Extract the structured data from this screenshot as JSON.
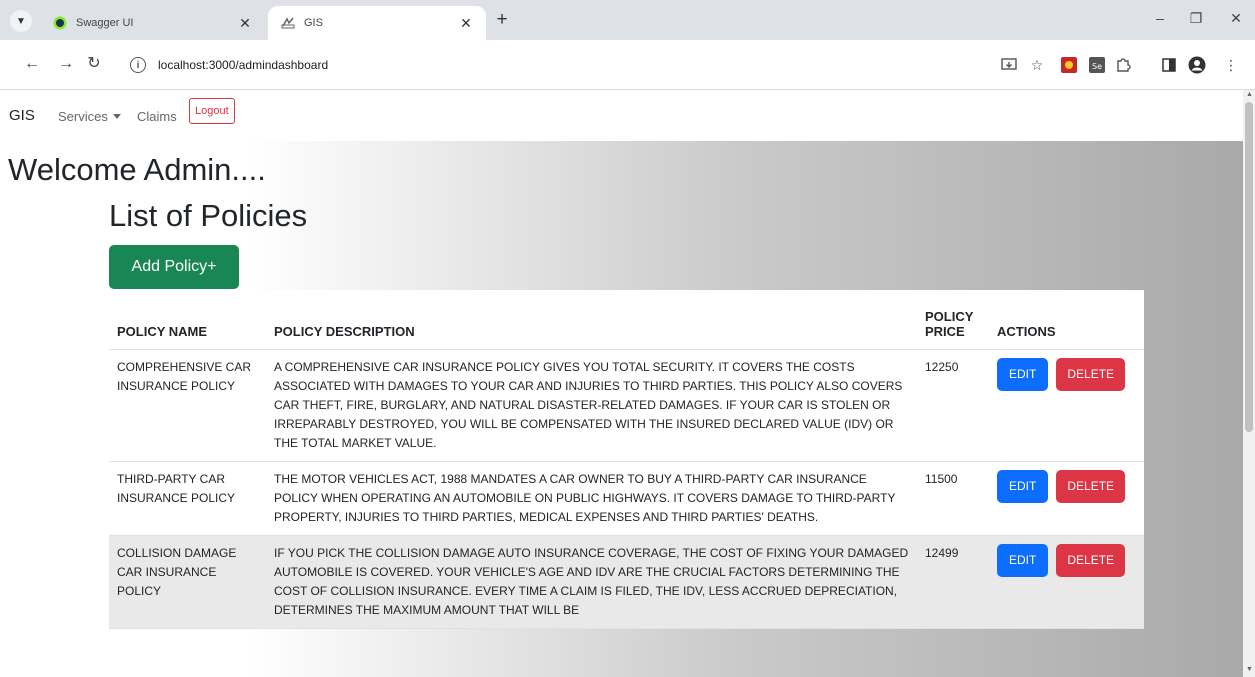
{
  "browser": {
    "tabs": [
      {
        "title": "Swagger UI",
        "active": false
      },
      {
        "title": "GIS",
        "active": true
      }
    ],
    "url": "localhost:3000/admindashboard"
  },
  "navbar": {
    "brand": "GIS",
    "services": "Services",
    "claims": "Claims",
    "logout": "Logout"
  },
  "page": {
    "welcome": "Welcome Admin....",
    "list_title": "List of Policies",
    "add_button": "Add Policy+"
  },
  "table": {
    "headers": {
      "name": "POLICY NAME",
      "description": "POLICY DESCRIPTION",
      "price": "POLICY PRICE",
      "actions": "ACTIONS"
    },
    "edit_label": "EDIT",
    "delete_label": "DELETE",
    "rows": [
      {
        "name": "COMPREHENSIVE CAR INSURANCE POLICY",
        "description": "A COMPREHENSIVE CAR INSURANCE POLICY GIVES YOU TOTAL SECURITY. IT COVERS THE COSTS ASSOCIATED WITH DAMAGES TO YOUR CAR AND INJURIES TO THIRD PARTIES. THIS POLICY ALSO COVERS CAR THEFT, FIRE, BURGLARY, AND NATURAL DISASTER-RELATED DAMAGES. IF YOUR CAR IS STOLEN OR IRREPARABLY DESTROYED, YOU WILL BE COMPENSATED WITH THE INSURED DECLARED VALUE (IDV) OR THE TOTAL MARKET VALUE.",
        "price": "12250"
      },
      {
        "name": "THIRD-PARTY CAR INSURANCE POLICY",
        "description": "THE MOTOR VEHICLES ACT, 1988 MANDATES A CAR OWNER TO BUY A THIRD-PARTY CAR INSURANCE POLICY WHEN OPERATING AN AUTOMOBILE ON PUBLIC HIGHWAYS. IT COVERS DAMAGE TO THIRD-PARTY PROPERTY, INJURIES TO THIRD PARTIES, MEDICAL EXPENSES AND THIRD PARTIES' DEATHS.",
        "price": "11500"
      },
      {
        "name": "COLLISION DAMAGE CAR INSURANCE POLICY",
        "description": "IF YOU PICK THE COLLISION DAMAGE AUTO INSURANCE COVERAGE, THE COST OF FIXING YOUR DAMAGED AUTOMOBILE IS COVERED. YOUR VEHICLE'S AGE AND IDV ARE THE CRUCIAL FACTORS DETERMINING THE COST OF COLLISION INSURANCE. EVERY TIME A CLAIM IS FILED, THE IDV, LESS ACCRUED DEPRECIATION, DETERMINES THE MAXIMUM AMOUNT THAT WILL BE",
        "price": "12499"
      }
    ]
  },
  "colors": {
    "add_button": "#198754",
    "edit_button": "#0d6efd",
    "delete_button": "#dc3545"
  }
}
